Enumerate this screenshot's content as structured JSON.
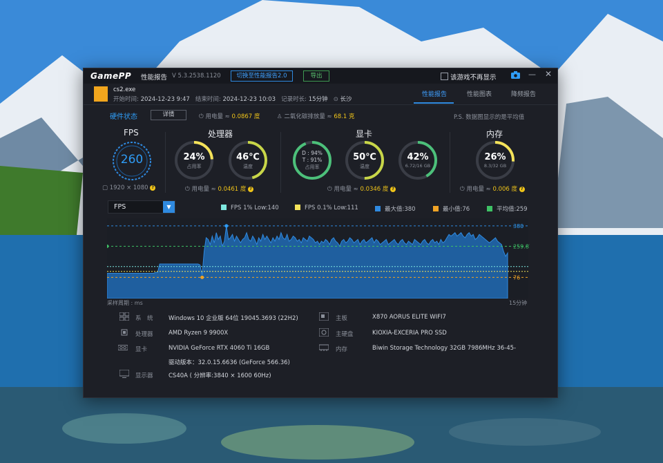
{
  "titlebar": {
    "logo": "GamePP",
    "title": "性能报告",
    "version": "V 5.3.2538.1120",
    "switch_label": "切换至性能报告2.0",
    "export_label": "导出",
    "no_show_label": "该游戏不再显示"
  },
  "session": {
    "game": "cs2.exe",
    "start_label": "开始时间:",
    "start": "2024-12-23 9:47",
    "end_label": "结束时间:",
    "end": "2024-12-23 10:03",
    "duration_label": "记录时长:",
    "duration": "15分钟",
    "location": "长沙"
  },
  "tabs": [
    "性能报告",
    "性能图表",
    "降频报告"
  ],
  "hardware": {
    "state_label": "硬件状态",
    "detail_label": "详情",
    "power_label": "用电量 ≈",
    "power_value": "0.0867 度",
    "co2_label": "二氧化碳排放量 ≈",
    "co2_value": "68.1 克",
    "ps_note": "P.S. 数据图显示的是平均值"
  },
  "fps": {
    "title": "FPS",
    "value": "260",
    "resolution": "1920 × 1080"
  },
  "cpu": {
    "title": "处理器",
    "usage": "24%",
    "usage_label": "占用率",
    "usage_fraction": 0.24,
    "temp": "46℃",
    "temp_label": "温度",
    "temp_fraction": 0.46,
    "power_label": "用电量 ≈",
    "power_value": "0.0461 度"
  },
  "gpu": {
    "title": "显卡",
    "d_usage": "D : 94%",
    "t_usage": "T : 91%",
    "usage_label": "占用率",
    "usage_fraction": 0.94,
    "temp": "50℃",
    "temp_label": "温度",
    "temp_fraction": 0.5,
    "vram": "42%",
    "vram_sub": "6.72/16 GB",
    "vram_fraction": 0.42,
    "power_label": "用电量 ≈",
    "power_value": "0.0346 度"
  },
  "memory": {
    "title": "内存",
    "usage": "26%",
    "sub": "8.3/32 GB",
    "usage_fraction": 0.26,
    "power_label": "用电量 ≈",
    "power_value": "0.006 度"
  },
  "chart_controls": {
    "selected": "FPS",
    "legend": [
      {
        "label": "FPS 1% Low:140",
        "color": "#7ee8e0"
      },
      {
        "label": "FPS 0.1% Low:111",
        "color": "#f5e35a"
      },
      {
        "label": "最大值:380",
        "color": "#2f8ae0"
      },
      {
        "label": "最小值:76",
        "color": "#f0a325"
      },
      {
        "label": "平均值:259",
        "color": "#3ec265"
      }
    ],
    "x_start_label": "采样周期 : ms",
    "x_end_label": "15分钟"
  },
  "chart_data": {
    "type": "area",
    "ylim": [
      0,
      400
    ],
    "y_labels": [
      "380",
      "259.87",
      "76"
    ],
    "max": 380,
    "min": 76,
    "avg": 259.87,
    "low1": 140,
    "low01": 111,
    "series": [
      {
        "values": [
          100,
          100,
          100,
          100,
          100,
          100,
          100,
          100,
          100,
          100,
          100,
          100,
          100,
          100,
          100,
          100,
          100,
          100,
          100,
          100,
          100,
          100,
          100,
          100,
          105,
          105,
          155,
          155,
          155,
          155,
          155,
          155,
          155,
          155,
          155,
          155,
          155,
          155,
          155,
          155,
          155,
          155,
          155,
          155,
          155,
          155,
          150,
          90,
          230,
          310,
          300,
          270,
          320,
          280,
          340,
          300,
          320,
          260,
          290,
          380,
          300,
          310,
          330,
          290,
          320,
          300,
          280,
          300,
          310,
          340,
          300,
          290,
          320,
          300,
          270,
          310,
          290,
          330,
          300,
          320,
          300,
          280,
          310,
          290,
          320,
          300,
          340,
          310,
          300,
          330,
          290,
          300,
          320,
          310,
          290,
          300,
          280,
          310,
          300,
          290,
          320,
          310,
          300,
          280,
          290,
          270,
          290,
          280,
          300,
          290,
          270,
          300,
          310,
          290,
          280,
          260,
          290,
          300,
          280,
          290,
          310,
          300,
          280,
          290,
          300,
          270,
          290,
          300,
          280,
          290,
          300,
          310,
          280,
          300,
          290,
          270,
          280,
          290,
          300,
          270,
          280,
          290,
          300,
          280,
          270,
          290,
          300,
          280,
          270,
          290,
          280,
          270,
          300,
          290,
          280,
          270,
          290,
          300,
          280,
          270,
          290,
          300,
          280,
          290,
          270,
          300,
          280,
          290,
          310,
          330,
          320,
          330,
          340,
          320,
          330,
          340,
          320,
          310,
          330,
          340,
          320,
          330,
          300,
          310,
          330,
          320,
          310,
          300,
          290,
          280,
          290,
          300,
          310,
          290,
          280,
          270,
          230,
          200,
          220
        ]
      }
    ]
  },
  "system": {
    "os_label": "系　统",
    "os": "Windows 10 企业版 64位 19045.3693 (22H2)",
    "cpu_label": "处理器",
    "cpu": "AMD Ryzen 9 9900X",
    "gpu_label": "显卡",
    "gpu": "NVIDIA GeForce RTX 4060 Ti 16GB",
    "driver": "驱动版本：32.0.15.6636 (GeForce 566.36)",
    "monitor_label": "显示器",
    "monitor": "CS40A ( 分辨率:3840 × 1600 60Hz)",
    "board_label": "主板",
    "board": "X870 AORUS ELITE WIFI7",
    "disk_label": "主硬盘",
    "disk": "KIOXIA-EXCERIA PRO SSD",
    "ram_label": "内存",
    "ram": "Biwin Storage Technology 32GB 7986MHz 36-45-"
  }
}
